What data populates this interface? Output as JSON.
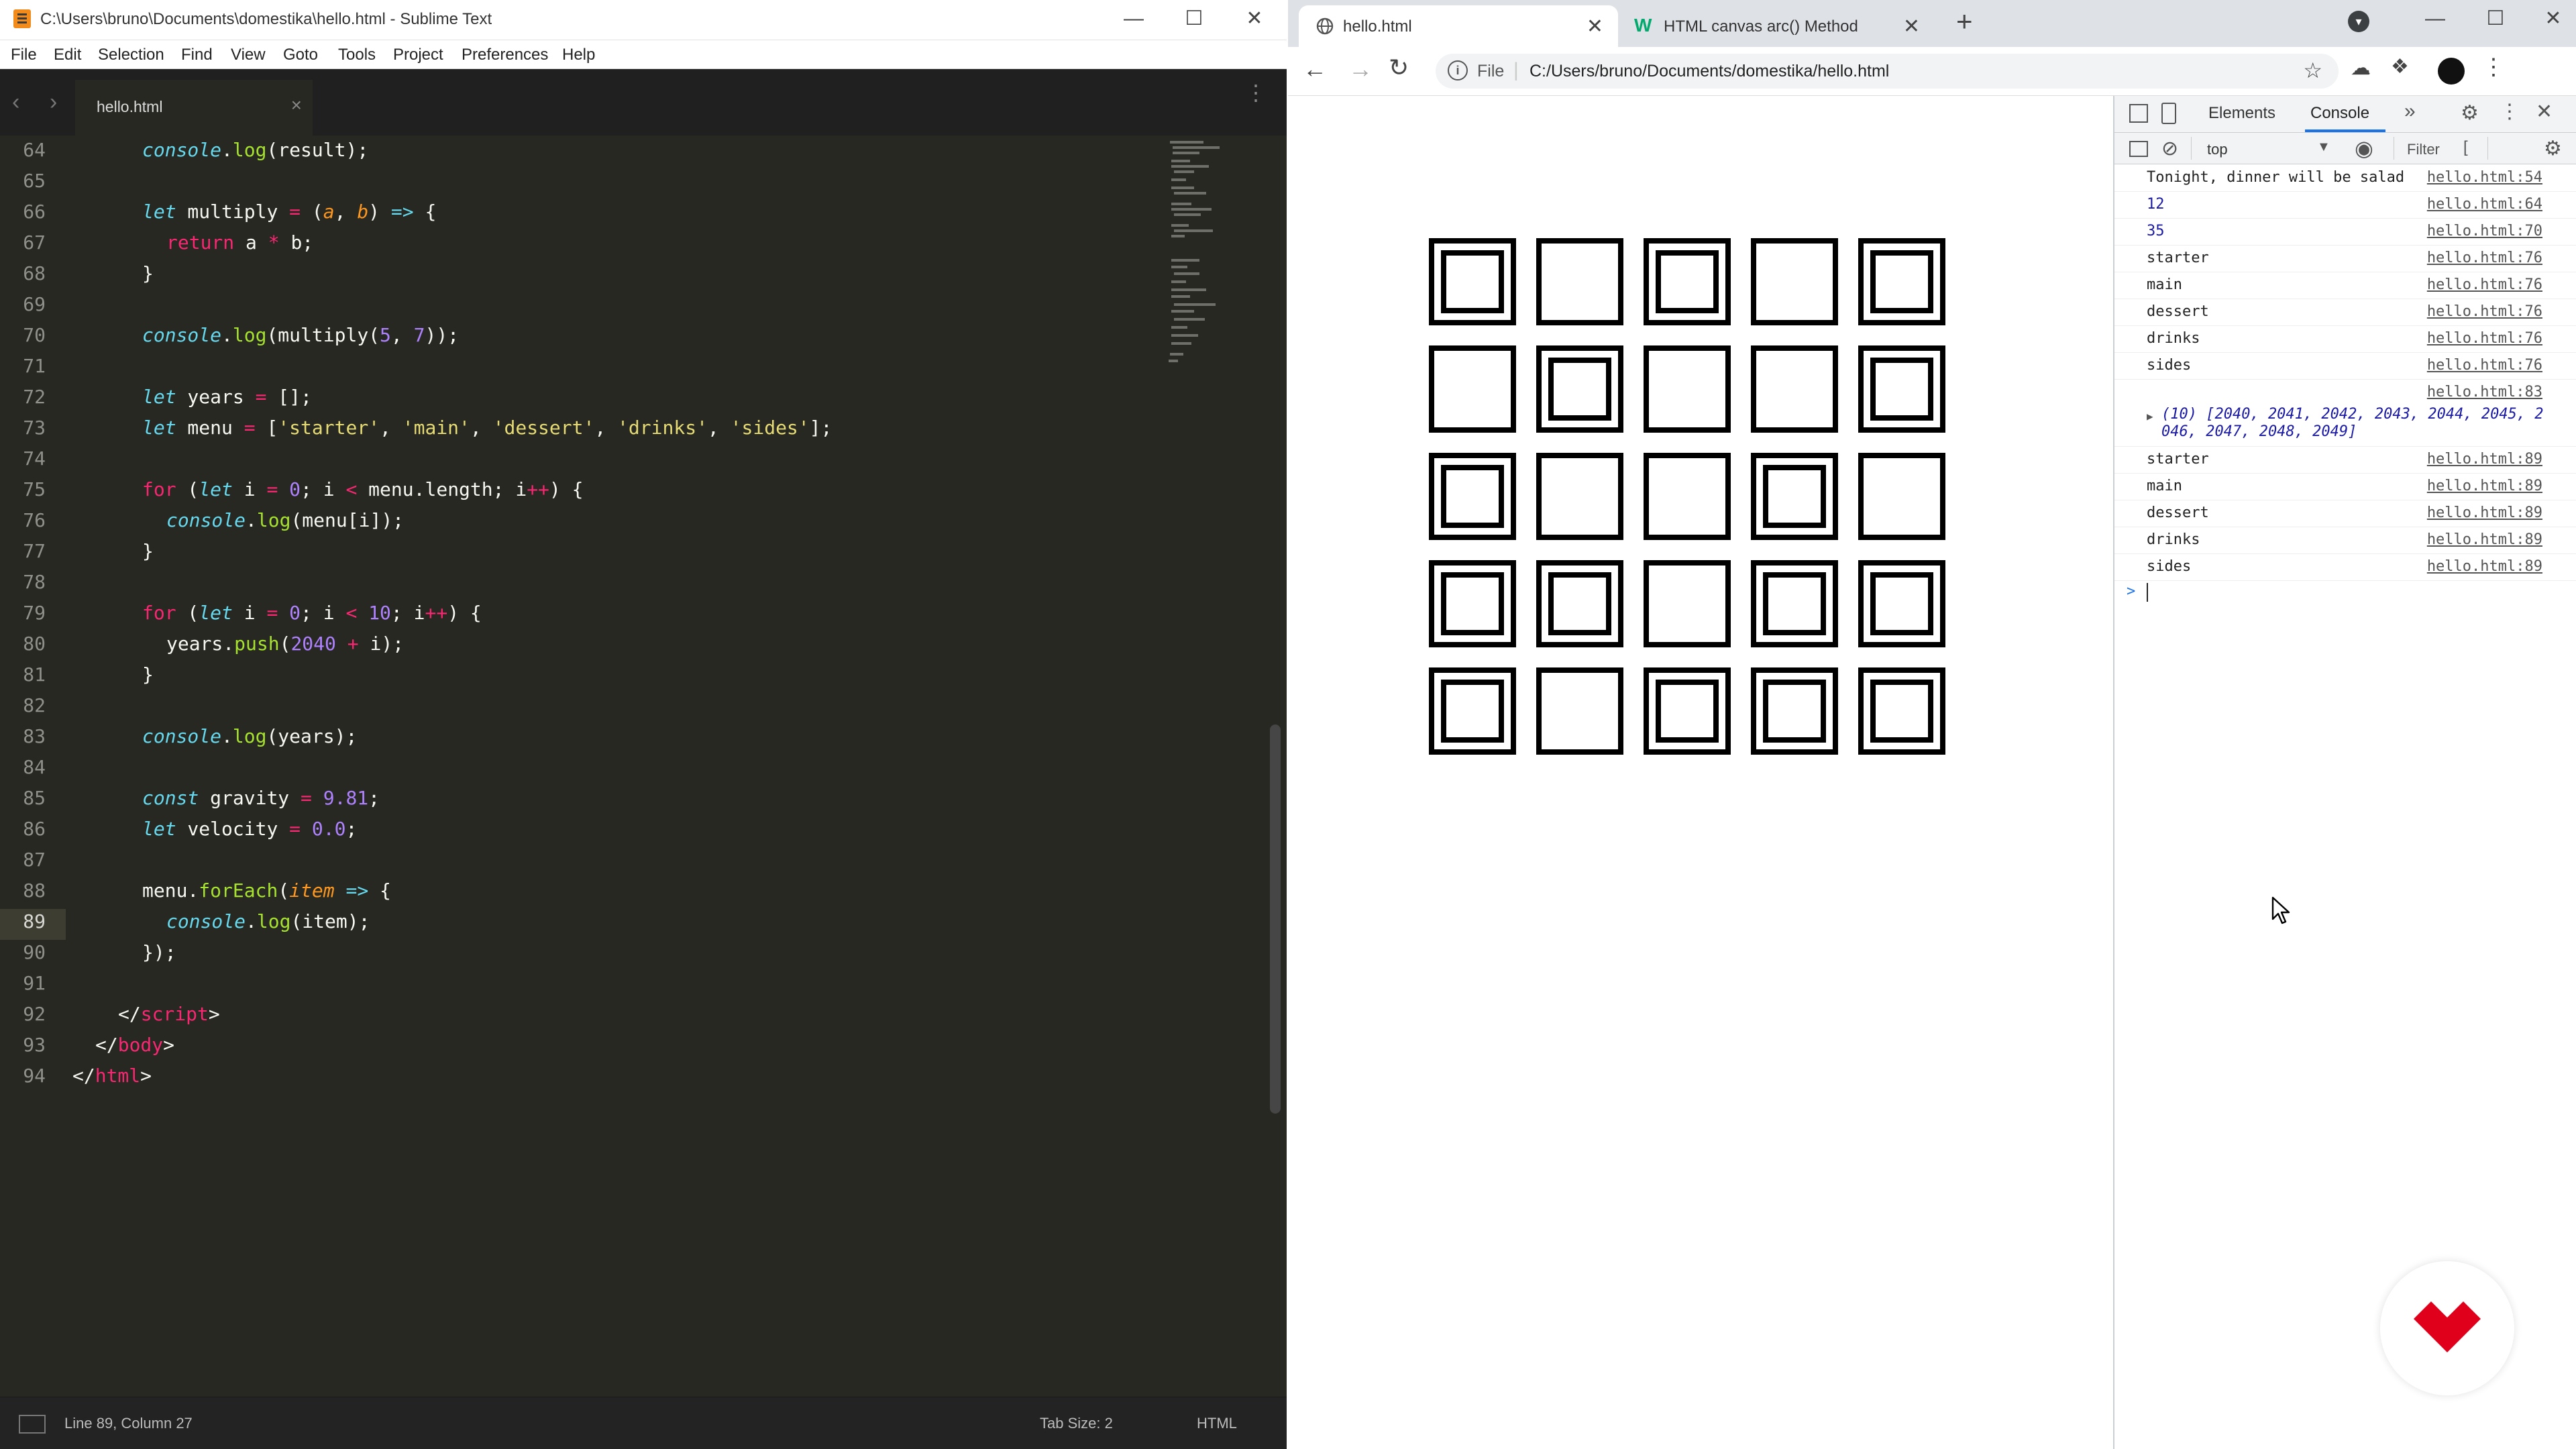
{
  "sublime": {
    "title": "C:\\Users\\bruno\\Documents\\domestika\\hello.html - Sublime Text",
    "menu": [
      "File",
      "Edit",
      "Selection",
      "Find",
      "View",
      "Goto",
      "Tools",
      "Project",
      "Preferences",
      "Help"
    ],
    "tab": "hello.html",
    "line_numbers": [
      "64",
      "65",
      "66",
      "67",
      "68",
      "69",
      "70",
      "71",
      "72",
      "73",
      "74",
      "75",
      "76",
      "77",
      "78",
      "79",
      "80",
      "81",
      "82",
      "83",
      "84",
      "85",
      "86",
      "87",
      "88",
      "89",
      "90",
      "91",
      "92",
      "93",
      "94"
    ],
    "code": {
      "l64": {
        "a": "console",
        "b": ".",
        "c": "log",
        "d": "(result);"
      },
      "l66": {
        "a": "let",
        "b": " multiply ",
        "c": "=",
        "d": " (",
        "e": "a",
        "f": ", ",
        "g": "b",
        "h": ") ",
        "i": "=>",
        "j": " {"
      },
      "l67": {
        "a": "return",
        "b": " a ",
        "c": "*",
        "d": " b;"
      },
      "l68": {
        "a": "}"
      },
      "l70": {
        "a": "console",
        "b": ".",
        "c": "log",
        "d": "(multiply(",
        "e": "5",
        "f": ", ",
        "g": "7",
        "h": "));"
      },
      "l72": {
        "a": "let",
        "b": " years ",
        "c": "=",
        "d": " [];"
      },
      "l73": {
        "a": "let",
        "b": " menu ",
        "c": "=",
        "d": " [",
        "e": "'starter'",
        "f": ", ",
        "g": "'main'",
        "h": ", ",
        "i": "'dessert'",
        "j": ", ",
        "k": "'drinks'",
        "l": ", ",
        "m": "'sides'",
        "n": "];"
      },
      "l75": {
        "a": "for",
        "b": " (",
        "c": "let",
        "d": " i ",
        "e": "=",
        "f": " ",
        "g": "0",
        "h": "; i ",
        "i": "<",
        "j": " menu.length; i",
        "k": "++",
        "l": ") {"
      },
      "l76": {
        "a": "console",
        "b": ".",
        "c": "log",
        "d": "(menu[i]);"
      },
      "l77": {
        "a": "}"
      },
      "l79": {
        "a": "for",
        "b": " (",
        "c": "let",
        "d": " i ",
        "e": "=",
        "f": " ",
        "g": "0",
        "h": "; i ",
        "i": "<",
        "j": " ",
        "k": "10",
        "l": "; i",
        "m": "++",
        "n": ") {"
      },
      "l80": {
        "a": "years.",
        "b": "push",
        "c": "(",
        "d": "2040",
        "e": " ",
        "f": "+",
        "g": " i);"
      },
      "l81": {
        "a": "}"
      },
      "l83": {
        "a": "console",
        "b": ".",
        "c": "log",
        "d": "(years);"
      },
      "l85": {
        "a": "const",
        "b": " gravity ",
        "c": "=",
        "d": " ",
        "e": "9.81",
        "f": ";"
      },
      "l86": {
        "a": "let",
        "b": " velocity ",
        "c": "=",
        "d": " ",
        "e": "0.0",
        "f": ";"
      },
      "l88": {
        "a": "menu.",
        "b": "forEach",
        "c": "(",
        "d": "item",
        "e": " ",
        "f": "=>",
        "g": " {"
      },
      "l89": {
        "a": "console",
        "b": ".",
        "c": "log",
        "d": "(item);"
      },
      "l90": {
        "a": "});"
      },
      "l92": {
        "a": "</",
        "b": "script",
        "c": ">"
      },
      "l93": {
        "a": "</",
        "b": "body",
        "c": ">"
      },
      "l94": {
        "a": "</",
        "b": "html",
        "c": ">"
      }
    },
    "status_left": "Line 89, Column 27",
    "status_tabsize": "Tab Size: 2",
    "status_syntax": "HTML"
  },
  "chrome": {
    "tabs": [
      {
        "label": "hello.html",
        "icon": "globe-icon"
      },
      {
        "label": "HTML canvas arc() Method",
        "icon": "w3schools-icon"
      }
    ],
    "url_scheme": "File",
    "url": "C:/Users/bruno/Documents/domestika/hello.html",
    "grid": {
      "rows": 5,
      "cols": 5,
      "inner": [
        [
          1,
          0,
          1,
          0,
          1
        ],
        [
          0,
          1,
          0,
          0,
          1
        ],
        [
          1,
          0,
          0,
          1,
          0
        ],
        [
          1,
          1,
          0,
          1,
          1
        ],
        [
          1,
          0,
          1,
          1,
          1
        ]
      ]
    },
    "devtools": {
      "tabs": [
        "Elements",
        "Console"
      ],
      "context": "top",
      "filter_placeholder": "Filter",
      "messages": [
        {
          "text": "Tonight, dinner will be salad",
          "src": "hello.html:54"
        },
        {
          "text": "12",
          "src": "hello.html:64",
          "numeric": true
        },
        {
          "text": "35",
          "src": "hello.html:70",
          "numeric": true
        },
        {
          "text": "starter",
          "src": "hello.html:76"
        },
        {
          "text": "main",
          "src": "hello.html:76"
        },
        {
          "text": "dessert",
          "src": "hello.html:76"
        },
        {
          "text": "drinks",
          "src": "hello.html:76"
        },
        {
          "text": "sides",
          "src": "hello.html:76"
        }
      ],
      "array_src": "hello.html:83",
      "array_line1": "(10) [2040, 2041, 2042, 2043, 2044, 2045, 2",
      "array_line2": "046, 2047, 2048, 2049]",
      "messages2": [
        {
          "text": "starter",
          "src": "hello.html:89"
        },
        {
          "text": "main",
          "src": "hello.html:89"
        },
        {
          "text": "dessert",
          "src": "hello.html:89"
        },
        {
          "text": "drinks",
          "src": "hello.html:89"
        },
        {
          "text": "sides",
          "src": "hello.html:89"
        }
      ],
      "prompt": ">"
    }
  },
  "colors": {
    "editor_bg": "#272822",
    "keyword": "#f92672",
    "storage": "#66d9ef",
    "function": "#a6e22e",
    "string": "#e6db74",
    "number": "#ae81ff",
    "param": "#fd971f",
    "logo": "#e0001b"
  }
}
